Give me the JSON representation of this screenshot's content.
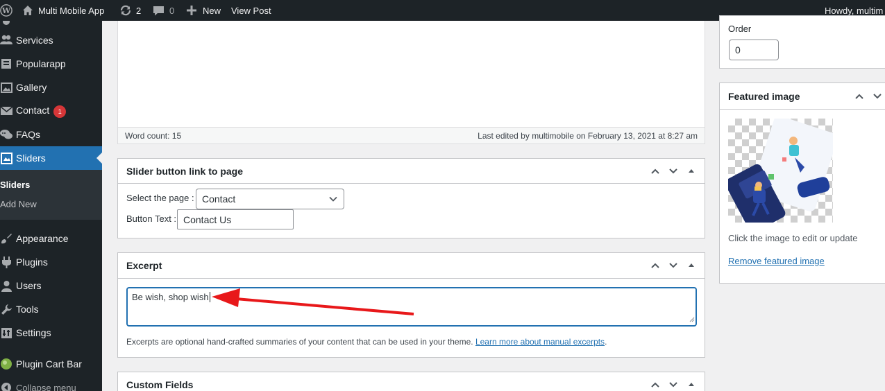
{
  "admin_bar": {
    "wp_logo": "wordpress-icon",
    "site_name": "Multi Mobile App",
    "updates_count": "2",
    "comments_count": "0",
    "new_label": "New",
    "view_post_label": "View Post",
    "howdy": "Howdy, multim"
  },
  "menu": {
    "items": [
      {
        "label": "Services",
        "icon": "people-icon"
      },
      {
        "label": "Popularapp",
        "icon": "admin-post-icon"
      },
      {
        "label": "Gallery",
        "icon": "gallery-icon"
      },
      {
        "label": "Contact",
        "icon": "email-icon",
        "badge": "1"
      },
      {
        "label": "FAQs",
        "icon": "chat-icon"
      },
      {
        "label": "Sliders",
        "icon": "slides-icon"
      },
      {
        "label": "Appearance",
        "icon": "brush-icon"
      },
      {
        "label": "Plugins",
        "icon": "plugin-icon"
      },
      {
        "label": "Users",
        "icon": "users-icon"
      },
      {
        "label": "Tools",
        "icon": "wrench-icon"
      },
      {
        "label": "Settings",
        "icon": "settings-icon"
      },
      {
        "label": "Plugin Cart Bar",
        "icon": "cart-bar-icon"
      }
    ],
    "submenu": [
      "Sliders",
      "Add New"
    ],
    "collapse_label": "Collapse menu"
  },
  "editor": {
    "word_count": "Word count: 15",
    "last_edited": "Last edited by multimobile on February 13, 2021 at 8:27 am"
  },
  "slider_link_box": {
    "title": "Slider button link to page",
    "select_label": "Select the page :",
    "select_value": "Contact",
    "button_text_label": "Button Text :",
    "button_text_value": "Contact Us"
  },
  "excerpt_box": {
    "title": "Excerpt",
    "value": "Be wish, shop wish",
    "help_text": "Excerpts are optional hand-crafted summaries of your content that can be used in your theme.",
    "help_link": "Learn more about manual excerpts",
    "help_end": "."
  },
  "custom_fields_box": {
    "title": "Custom Fields"
  },
  "attributes_box": {
    "order_label": "Order",
    "order_value": "0"
  },
  "featured_image_box": {
    "title": "Featured image",
    "click_hint": "Click the image to edit or update",
    "remove_link": "Remove featured image"
  },
  "colors": {
    "admin_dark": "#1d2327",
    "accent_blue": "#2271b1",
    "annotation_red": "#e8181a"
  }
}
